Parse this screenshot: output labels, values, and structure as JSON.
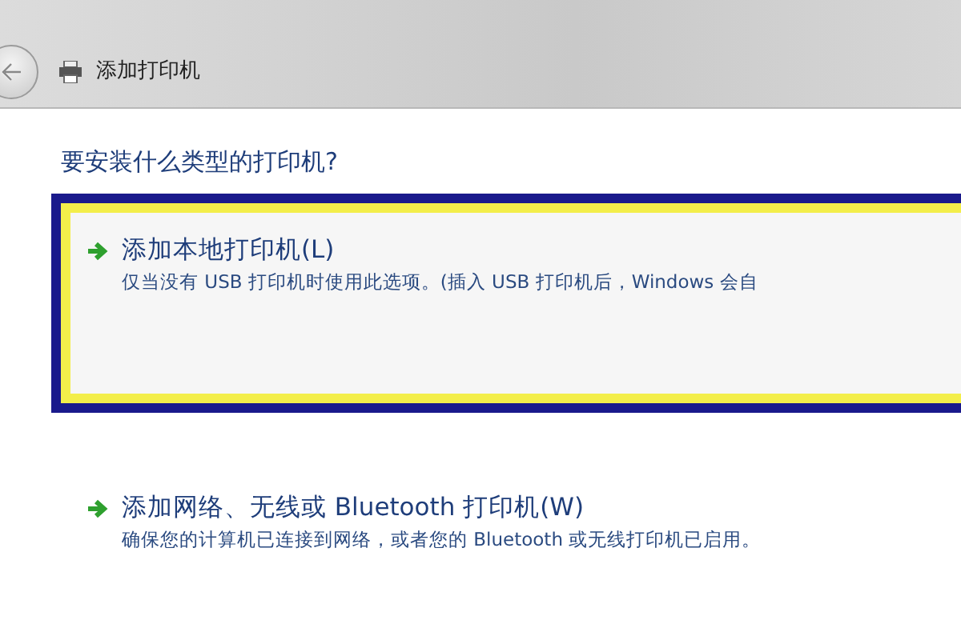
{
  "window": {
    "title": "添加打印机"
  },
  "heading": "要安装什么类型的打印机?",
  "options": [
    {
      "title": "添加本地打印机(L)",
      "description": "仅当没有 USB 打印机时使用此选项。(插入 USB 打印机后，Windows 会自",
      "selected": true
    },
    {
      "title": "添加网络、无线或 Bluetooth 打印机(W)",
      "description": "确保您的计算机已连接到网络，或者您的 Bluetooth 或无线打印机已启用。",
      "selected": false
    }
  ]
}
